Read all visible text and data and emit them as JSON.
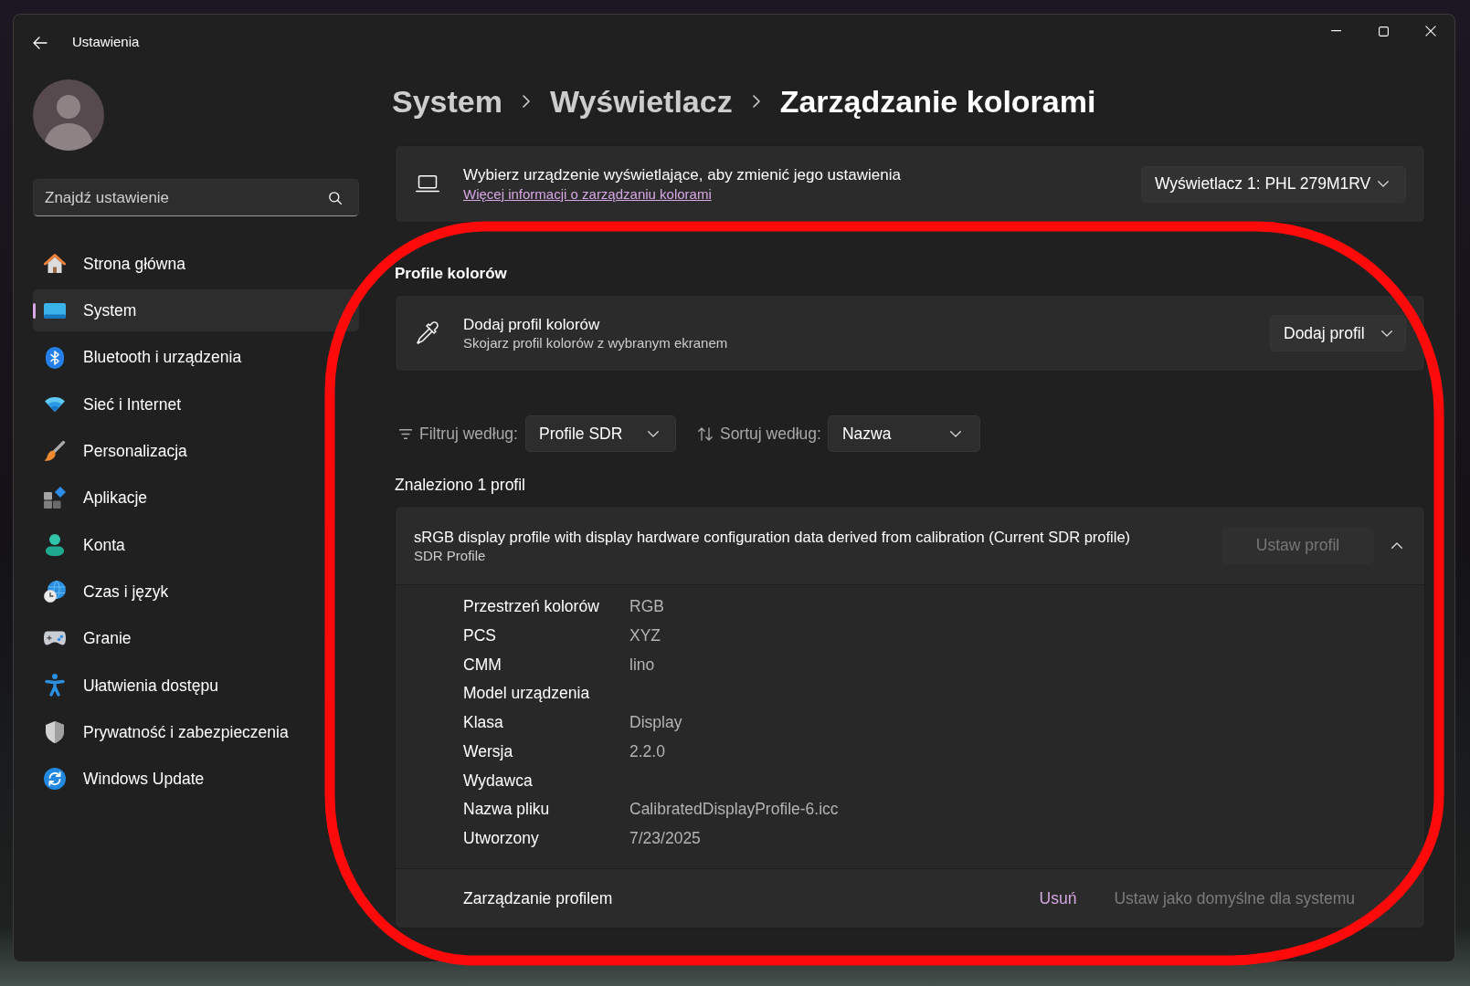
{
  "window": {
    "title": "Ustawienia"
  },
  "search": {
    "placeholder": "Znajdź ustawienie"
  },
  "sidebar": {
    "items": [
      {
        "label": "Strona główna",
        "selected": false
      },
      {
        "label": "System",
        "selected": true
      },
      {
        "label": "Bluetooth i urządzenia",
        "selected": false
      },
      {
        "label": "Sieć i Internet",
        "selected": false
      },
      {
        "label": "Personalizacja",
        "selected": false
      },
      {
        "label": "Aplikacje",
        "selected": false
      },
      {
        "label": "Konta",
        "selected": false
      },
      {
        "label": "Czas i język",
        "selected": false
      },
      {
        "label": "Granie",
        "selected": false
      },
      {
        "label": "Ułatwienia dostępu",
        "selected": false
      },
      {
        "label": "Prywatność i zabezpieczenia",
        "selected": false
      },
      {
        "label": "Windows Update",
        "selected": false
      }
    ]
  },
  "breadcrumb": [
    {
      "label": "System",
      "current": false
    },
    {
      "label": "Wyświetlacz",
      "current": false
    },
    {
      "label": "Zarządzanie kolorami",
      "current": true
    }
  ],
  "display_card": {
    "title": "Wybierz urządzenie wyświetlające, aby zmienić jego ustawienia",
    "link": "Więcej informacji o zarządzaniu kolorami",
    "dropdown": "Wyświetlacz 1: PHL 279M1RV"
  },
  "color_profiles": {
    "heading": "Profile kolorów",
    "add_card": {
      "title": "Dodaj profil kolorów",
      "subtitle": "Skojarz profil kolorów z wybranym ekranem",
      "button": "Dodaj profil"
    },
    "filter": {
      "label": "Filtruj według:",
      "value": "Profile SDR"
    },
    "sort": {
      "label": "Sortuj według:",
      "value": "Nazwa"
    },
    "result_count": "Znaleziono 1 profil",
    "profiles": [
      {
        "title": "sRGB display profile with display hardware configuration data derived from calibration (Current SDR profile)",
        "subtitle": "SDR Profile",
        "set_button": {
          "label": "Ustaw profil",
          "disabled": true
        },
        "expanded": true,
        "details": [
          {
            "label": "Przestrzeń kolorów",
            "value": "RGB"
          },
          {
            "label": "PCS",
            "value": "XYZ"
          },
          {
            "label": "CMM",
            "value": "lino"
          },
          {
            "label": "Model urządzenia"
          },
          {
            "label": "Klasa",
            "value": "Display"
          },
          {
            "label": "Wersja",
            "value": "2.2.0"
          },
          {
            "label": "Wydawca"
          },
          {
            "label": "Nazwa pliku",
            "value": "CalibratedDisplayProfile-6.icc"
          },
          {
            "label": "Utworzony",
            "value": "7/23/2025"
          }
        ],
        "management": {
          "label": "Zarządzanie profilem",
          "actions": [
            {
              "label": "Usuń",
              "disabled": false
            },
            {
              "label": "Ustaw jako domyślne dla systemu",
              "disabled": true
            }
          ]
        }
      }
    ]
  },
  "highlight_outline": true
}
